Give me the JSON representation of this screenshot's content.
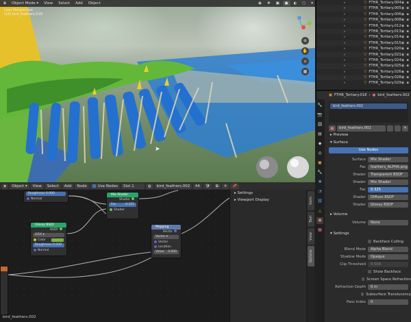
{
  "viewport": {
    "mode": "Object Mode",
    "menus": [
      "View",
      "Select",
      "Add",
      "Object"
    ],
    "info_lines": [
      "User Perspective",
      "(13) bird_feathers.018"
    ]
  },
  "node_editor": {
    "editor_type": "Object",
    "menus": [
      "View",
      "Select",
      "Add",
      "Node"
    ],
    "use_nodes_label": "Use Nodes",
    "slot": "Slot 1",
    "material": "bird_feathers.002",
    "user_count": "44",
    "footer_object": "bird_feathers.002",
    "nodes": {
      "mix_shader": {
        "title": "Mix Shader",
        "out": "Shader",
        "fac_value": "0.325",
        "in1": "Shader",
        "in2": "Shader",
        "fac_label": "Fac"
      },
      "glossy": {
        "title": "Glossy BSDF",
        "out": "BSDF",
        "dist": "GGX",
        "color": "Color",
        "roughness": "Roughness",
        "roughness_value": "0.500",
        "normal": "Normal"
      },
      "mapping": {
        "title": "Mapping",
        "out": "Vector",
        "type": "Vector",
        "input1": "Vector",
        "input2": "Location",
        "val_label": "Value",
        "val": "0.000"
      },
      "top_node": {
        "field1": "Roughness",
        "field1_val": "0.000",
        "field2": "Normal"
      }
    },
    "sidebar": {
      "items": [
        "Settings",
        "Viewport Display"
      ]
    },
    "tabs": [
      "Item",
      "Tool",
      "View",
      "Options"
    ]
  },
  "outliner": {
    "items": [
      "FTHR_Tertiary.004",
      "FTHR_Tertiary.005",
      "FTHR_Tertiary.006",
      "FTHR_Tertiary.008",
      "FTHR_Tertiary.012",
      "FTHR_Tertiary.013",
      "FTHR_Tertiary.014",
      "FTHR_Tertiary.015",
      "FTHR_Tertiary.020",
      "FTHR_Tertiary.021",
      "FTHR_Tertiary.024",
      "FTHR_Tertiary.025",
      "FTHR_Tertiary.026",
      "FTHR_Tertiary.028",
      "FTHR_Tertiary.029"
    ]
  },
  "properties": {
    "breadcrumb_object": "FTHR_Tertiary.018",
    "breadcrumb_material": "bird_feathers.002",
    "slot_name": "bird_feathers.002",
    "material_name": "bird_feathers.002",
    "sections": {
      "preview": "Preview",
      "surface": "Surface",
      "volume": "Volume",
      "settings": "Settings"
    },
    "use_nodes": "Use Nodes",
    "surface_rows": [
      {
        "label": "Surface",
        "value": "Mix Shader",
        "style": "plain"
      },
      {
        "label": "Fac",
        "value": "feathers_ALPHA.png",
        "style": "plain"
      },
      {
        "label": "Shader",
        "value": "Transparent BSDF",
        "style": "plain"
      },
      {
        "label": "Shader",
        "value": "Mix Shader",
        "style": "plain"
      },
      {
        "label": "Fac",
        "value": "0.325",
        "style": "blue"
      },
      {
        "label": "Shader",
        "value": "Diffuse BSDF",
        "style": "plain"
      },
      {
        "label": "Shader",
        "value": "Glossy BSDF",
        "style": "plain"
      }
    ],
    "volume_row": {
      "label": "Volume",
      "value": "None"
    },
    "settings_rows": [
      {
        "label": "",
        "value": "Backface Culling",
        "style": "check"
      },
      {
        "label": "Blend Mode",
        "value": "Alpha Blend",
        "style": "plain"
      },
      {
        "label": "Shadow Mode",
        "value": "Opaque",
        "style": "plain"
      },
      {
        "label": "Clip Threshold",
        "value": "0.500",
        "style": "dim"
      },
      {
        "label": "",
        "value": "Show Backface",
        "style": "check"
      },
      {
        "label": "",
        "value": "Screen Space Refraction",
        "style": "check"
      },
      {
        "label": "Refraction Depth",
        "value": "0 m",
        "style": "plain"
      },
      {
        "label": "",
        "value": "Subsurface Translucency",
        "style": "check"
      },
      {
        "label": "Pass Index",
        "value": "0",
        "style": "plain"
      }
    ]
  },
  "colors": {
    "accent": "#4772b3",
    "shader_node": "#2aa46a",
    "vector_node": "#5d7aa8",
    "socket_green": "#63c763",
    "socket_grey": "#a1a1a1",
    "socket_purple": "#6363c7",
    "socket_yellow": "#c7c729"
  }
}
